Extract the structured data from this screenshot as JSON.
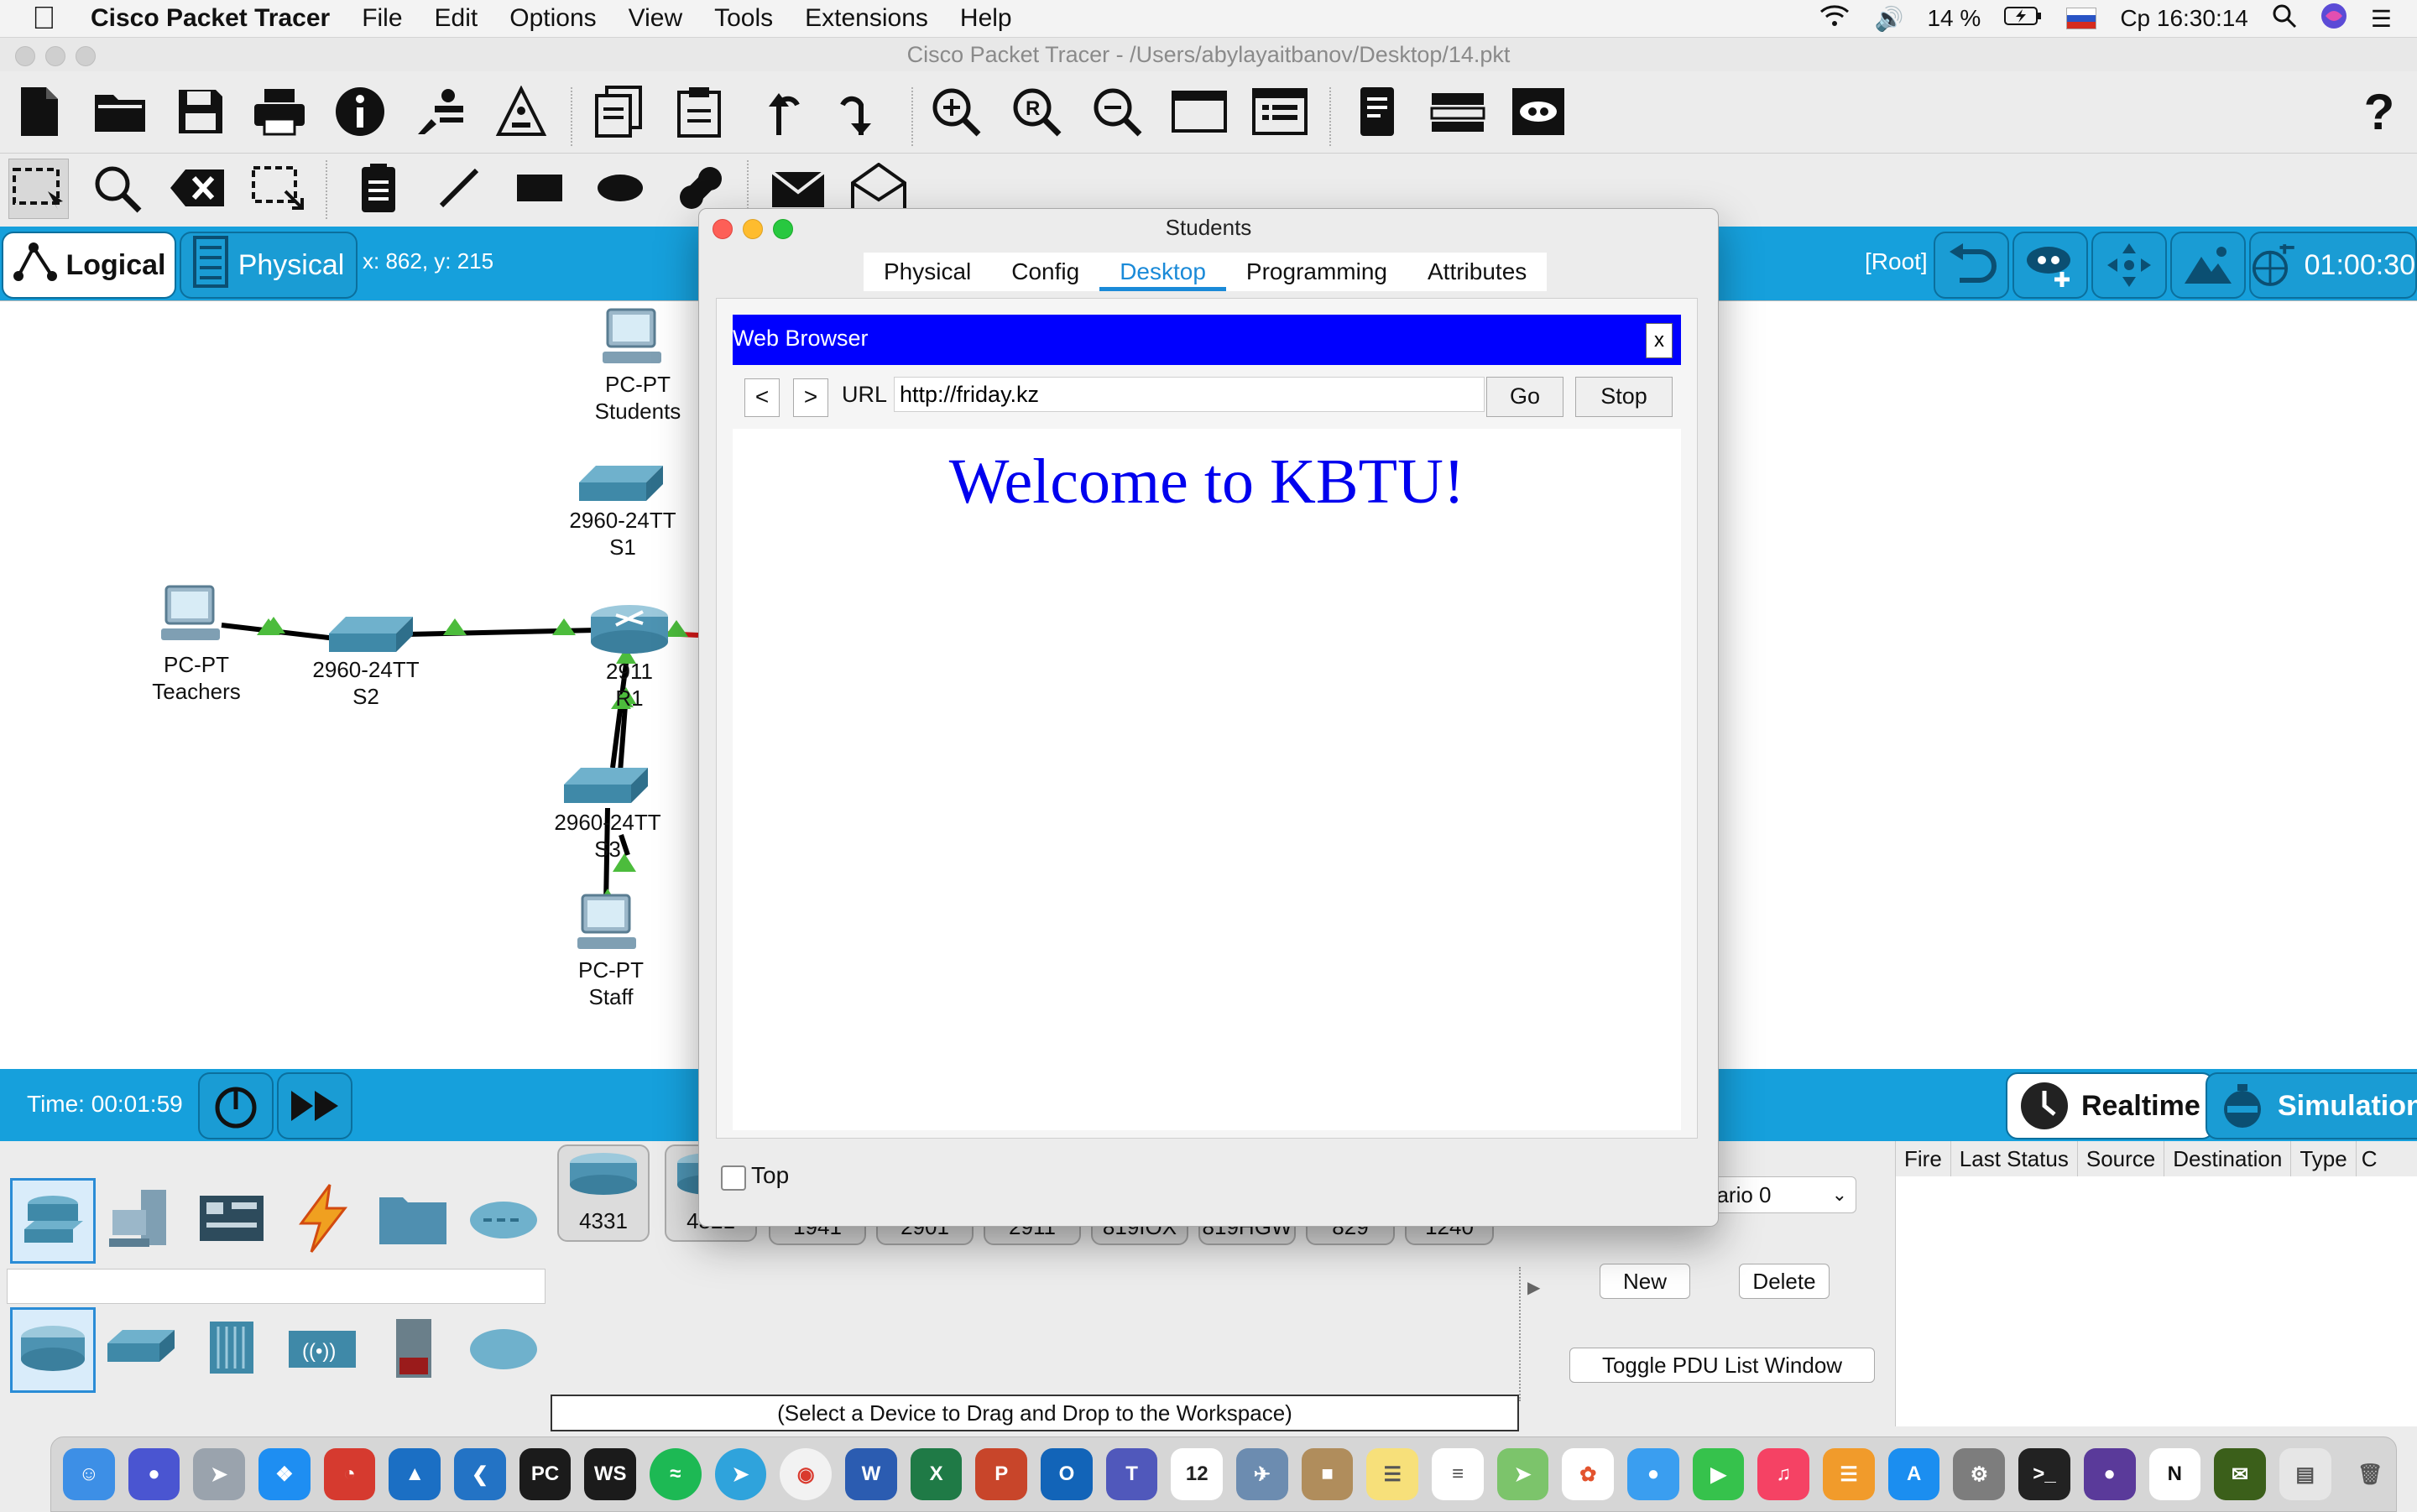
{
  "menubar": {
    "app_name": "Cisco Packet Tracer",
    "items": [
      "File",
      "Edit",
      "Options",
      "View",
      "Tools",
      "Extensions",
      "Help"
    ],
    "battery": "14 %",
    "clock": "Ср 16:30:14"
  },
  "window": {
    "title": "Cisco Packet Tracer - /Users/abylayaitbanov/Desktop/14.pkt"
  },
  "logical_bar": {
    "logical_label": "Logical",
    "physical_label": "Physical",
    "coords": "x: 862, y: 215",
    "root_label": "[Root]",
    "timer": "01:00:30"
  },
  "workspace": {
    "devices": [
      {
        "name": "PC-PT",
        "label": "Students"
      },
      {
        "name": "2960-24TT",
        "label": "S1"
      },
      {
        "name": "PC-PT",
        "label": "Teachers"
      },
      {
        "name": "2960-24TT",
        "label": "S2"
      },
      {
        "name": "2911",
        "label": "R1"
      },
      {
        "name": "2960-24TT",
        "label": "S3"
      },
      {
        "name": "PC-PT",
        "label": "Staff"
      }
    ]
  },
  "timebar": {
    "time": "Time: 00:01:59",
    "realtime_label": "Realtime",
    "simulation_label": "Simulation"
  },
  "bottom": {
    "models": [
      "4331",
      "4321",
      "1941",
      "2901",
      "2911",
      "819IOX",
      "819HGW",
      "829",
      "1240"
    ],
    "hint": "(Select a Device to Drag and Drop to the Workspace)",
    "scenario": "nario 0",
    "new_label": "New",
    "delete_label": "Delete",
    "toggle_label": "Toggle PDU List Window",
    "pdu_columns": [
      "Fire",
      "Last Status",
      "Source",
      "Destination",
      "Type",
      "C"
    ]
  },
  "dialog": {
    "title": "Students",
    "tabs": [
      "Physical",
      "Config",
      "Desktop",
      "Programming",
      "Attributes"
    ],
    "active_tab": "Desktop",
    "browser_title": "Web Browser",
    "close_label": "x",
    "back_label": "<",
    "forward_label": ">",
    "url_label": "URL",
    "url_value": "http://friday.kz",
    "go_label": "Go",
    "stop_label": "Stop",
    "page_heading": "Welcome to KBTU!",
    "top_label": "Top"
  },
  "colors": {
    "accent": "#16a0dc",
    "browser_header": "#0000ff",
    "link": "#0000ee"
  }
}
